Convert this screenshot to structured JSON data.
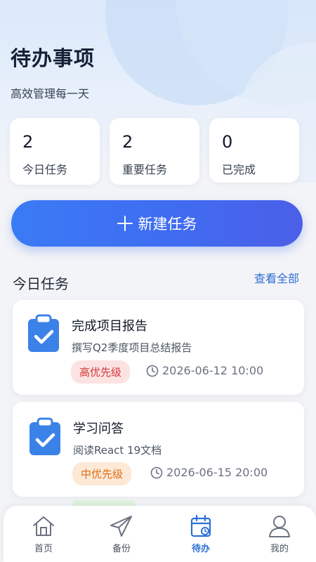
{
  "header": {
    "title": "待办事项",
    "subtitle": "高效管理每一天"
  },
  "stats": [
    {
      "value": "2",
      "label": "今日任务"
    },
    {
      "value": "2",
      "label": "重要任务"
    },
    {
      "value": "0",
      "label": "已完成"
    }
  ],
  "new_task_button": {
    "label": "新建任务"
  },
  "section": {
    "title": "今日任务",
    "view_all": "查看全部"
  },
  "tasks": [
    {
      "title": "完成项目报告",
      "description": "撰写Q2季度项目总结报告",
      "priority": "高优先级",
      "due": "2026-06-12 10:00"
    },
    {
      "title": "学习问答",
      "description": "阅读React 19文档",
      "priority": "中优先级",
      "due": "2026-06-15 20:00"
    }
  ],
  "tabs": [
    {
      "label": "首页",
      "icon": "home-icon"
    },
    {
      "label": "备份",
      "icon": "paper-plane-icon"
    },
    {
      "label": "待办",
      "icon": "calendar-icon",
      "active": true
    },
    {
      "label": "我的",
      "icon": "user-icon"
    }
  ],
  "colors": {
    "accent": "#3b7bf5",
    "high_priority": "#d33a3a",
    "mid_priority": "#d9701a",
    "active_tab": "#2f6fd6"
  }
}
